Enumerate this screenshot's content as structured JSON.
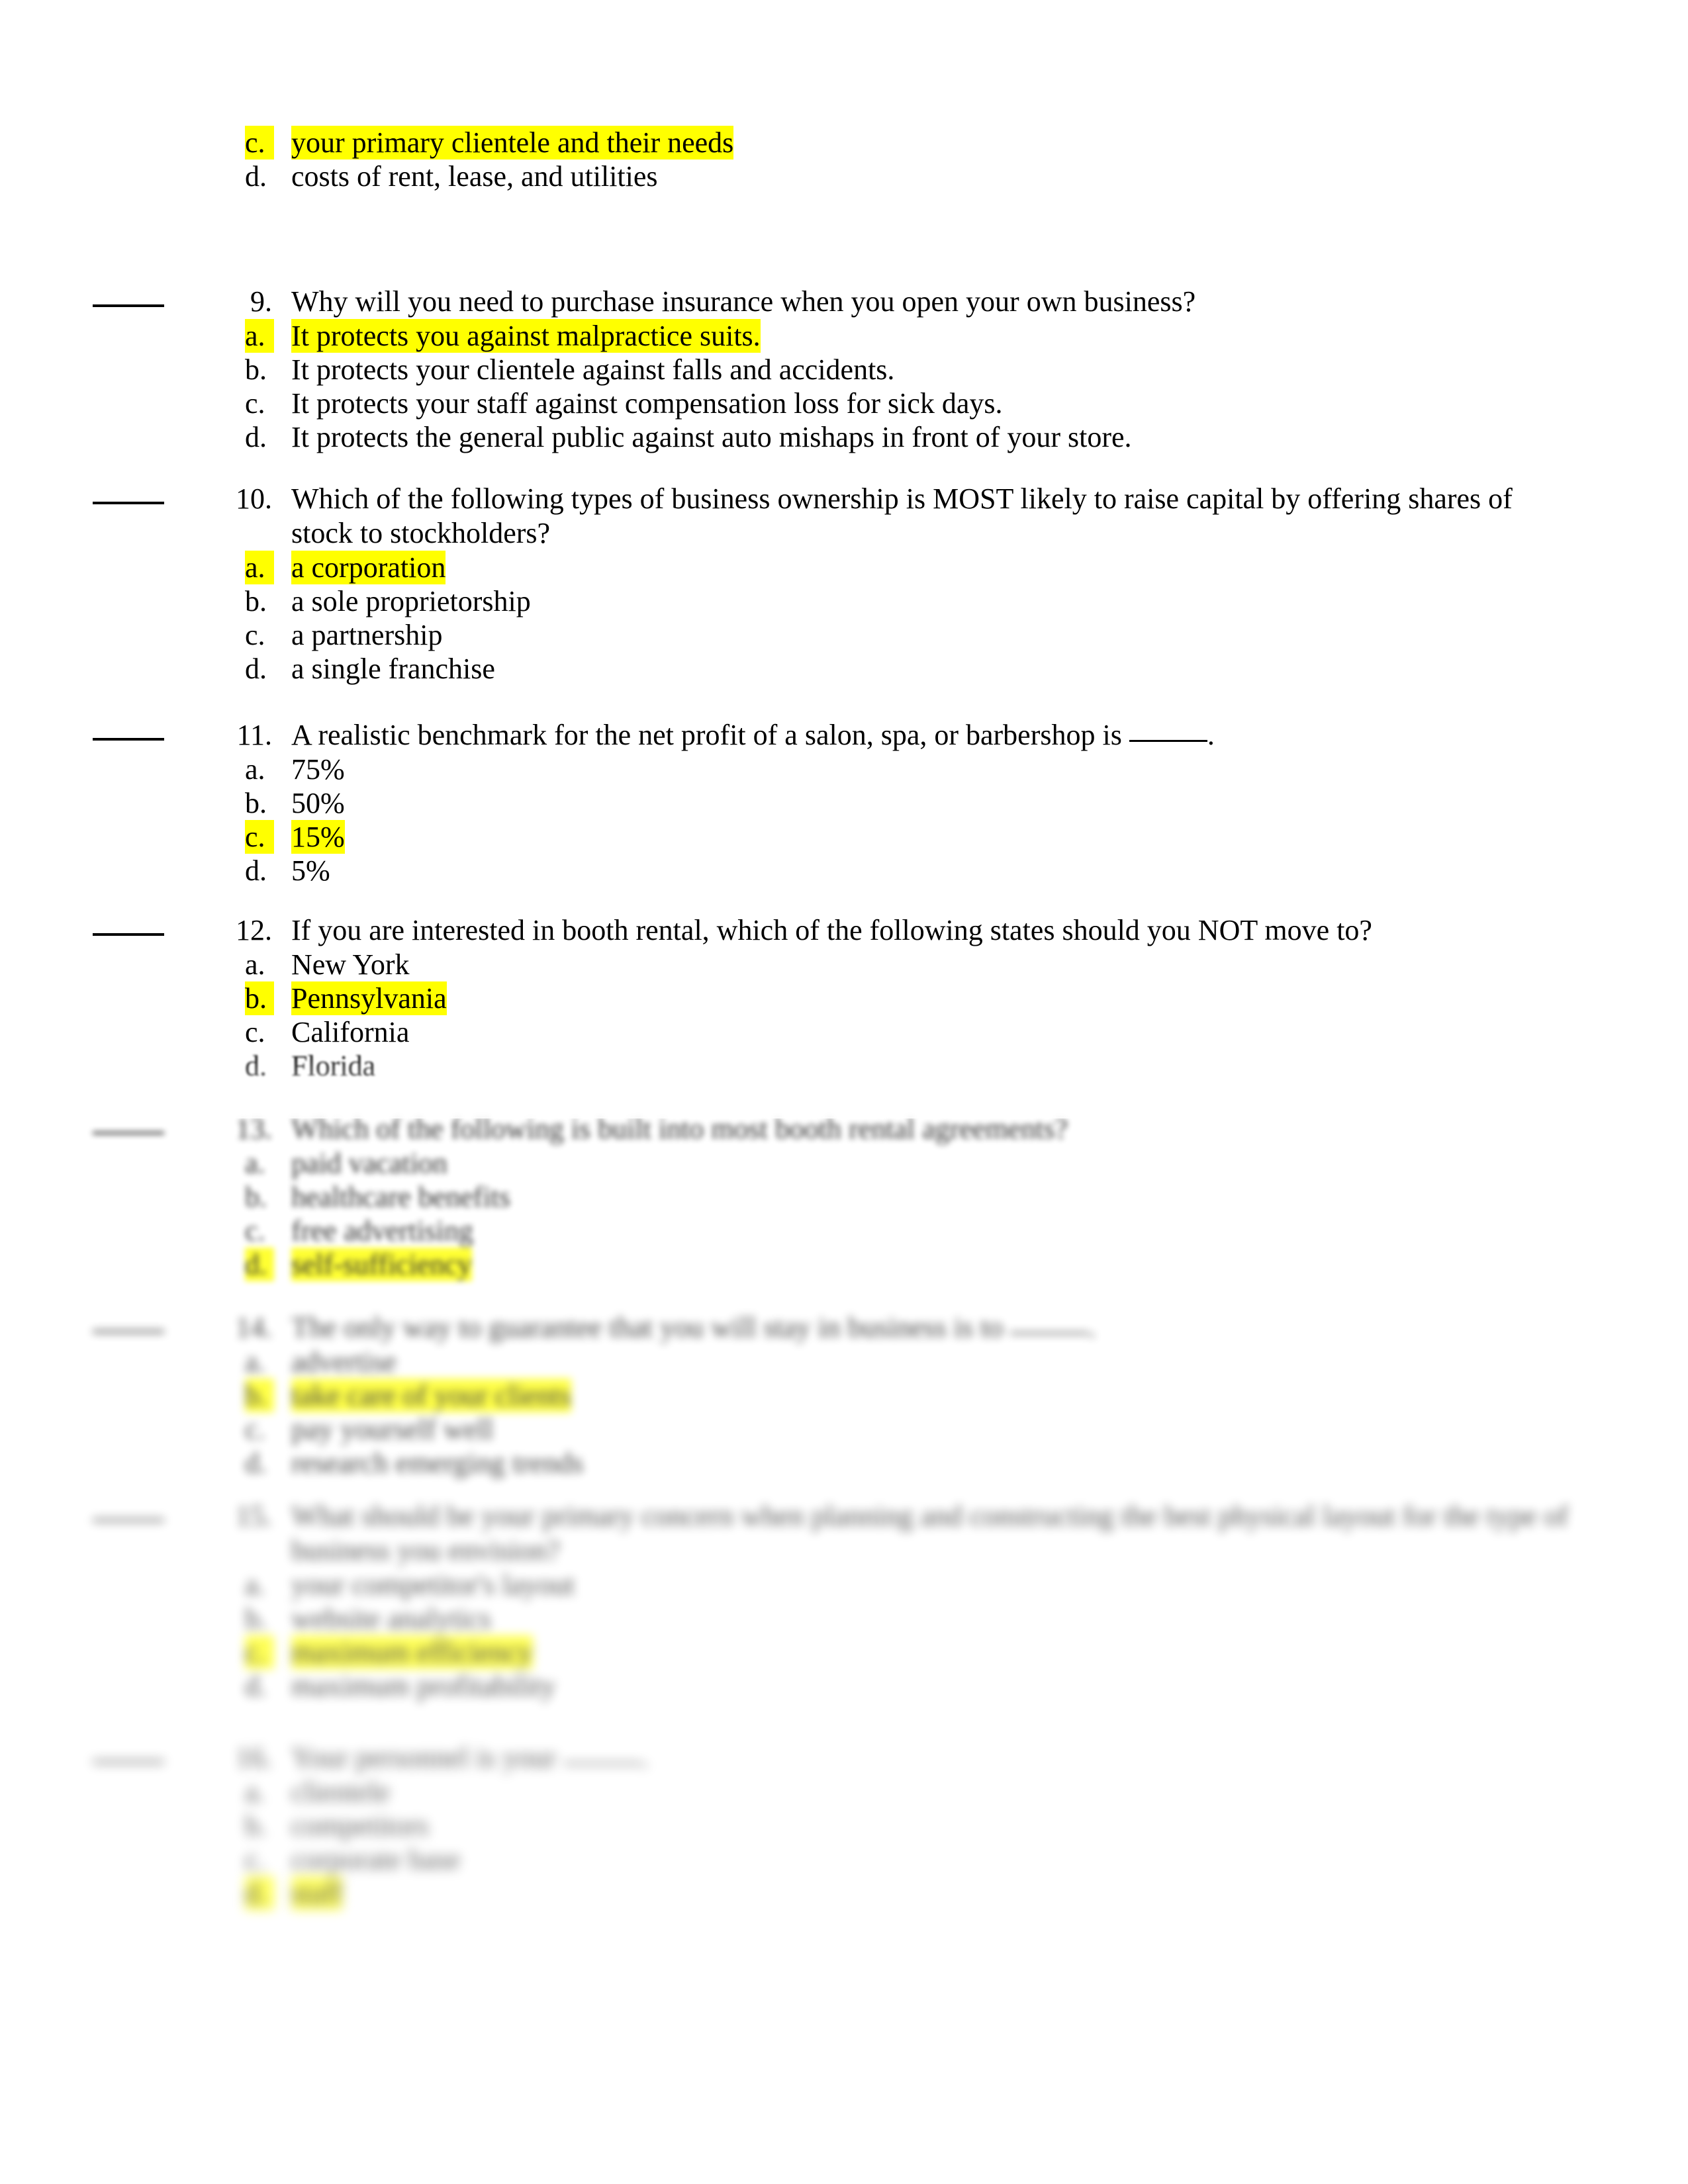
{
  "document": {
    "type": "multiple-choice-quiz-worksheet",
    "highlight_color": "#FFFF00",
    "page_background": "#FFFFFF",
    "text_color": "#000000"
  },
  "questions": [
    {
      "number": "",
      "partial": true,
      "text": "",
      "options": [
        {
          "marker": "c.",
          "text": "your primary clientele and their needs",
          "highlighted": true
        },
        {
          "marker": "d.",
          "text": "costs of rent, lease, and utilities",
          "highlighted": false
        }
      ]
    },
    {
      "number": "9.",
      "text": "Why will you need to purchase insurance when you open your own business?",
      "options": [
        {
          "marker": "a.",
          "text": "It protects you against malpractice suits.",
          "highlighted": true
        },
        {
          "marker": "b.",
          "text": "It protects your clientele against falls and accidents.",
          "highlighted": false
        },
        {
          "marker": "c.",
          "text": "It protects your staff against compensation loss for sick days.",
          "highlighted": false
        },
        {
          "marker": "d.",
          "text": "It protects the general public against auto mishaps in front of your store.",
          "highlighted": false
        }
      ]
    },
    {
      "number": "10.",
      "text": "Which of the following types of business ownership is MOST likely to raise capital by offering shares of",
      "text_cont": "stock to stockholders?",
      "options": [
        {
          "marker": "a.",
          "text": "a corporation",
          "highlighted": true
        },
        {
          "marker": "b.",
          "text": "a sole proprietorship",
          "highlighted": false
        },
        {
          "marker": "c.",
          "text": "a partnership",
          "highlighted": false
        },
        {
          "marker": "d.",
          "text": "a single franchise",
          "highlighted": false
        }
      ]
    },
    {
      "number": "11.",
      "text_before_blank": "A realistic benchmark for the net profit of a salon, spa, or barbershop is ",
      "text_after_blank": ".",
      "options": [
        {
          "marker": "a.",
          "text": "75%",
          "highlighted": false
        },
        {
          "marker": "b.",
          "text": "50%",
          "highlighted": false
        },
        {
          "marker": "c.",
          "text": "15%",
          "highlighted": true
        },
        {
          "marker": "d.",
          "text": "5%",
          "highlighted": false
        }
      ]
    },
    {
      "number": "12.",
      "text": "If you are interested in booth rental, which of the following states should you NOT move to?",
      "options": [
        {
          "marker": "a.",
          "text": "New York",
          "highlighted": false
        },
        {
          "marker": "b.",
          "text": "Pennsylvania",
          "highlighted": true
        },
        {
          "marker": "c.",
          "text": "California",
          "highlighted": false
        },
        {
          "marker": "d.",
          "text": "Florida",
          "highlighted": false
        }
      ]
    },
    {
      "number": "13.",
      "blurred": true,
      "text": "Which of the following is built into most booth rental agreements?",
      "options": [
        {
          "marker": "a.",
          "text": "paid vacation",
          "highlighted": false
        },
        {
          "marker": "b.",
          "text": "healthcare benefits",
          "highlighted": false
        },
        {
          "marker": "c.",
          "text": "free advertising",
          "highlighted": false
        },
        {
          "marker": "d.",
          "text": "self-sufficiency",
          "highlighted": true
        }
      ]
    },
    {
      "number": "14.",
      "blurred": true,
      "text_before_blank": "The only way to guarantee that you will stay in business is to ",
      "text_after_blank": ".",
      "options": [
        {
          "marker": "a.",
          "text": "advertise",
          "highlighted": false
        },
        {
          "marker": "b.",
          "text": "take care of your clients",
          "highlighted": true
        },
        {
          "marker": "c.",
          "text": "pay yourself well",
          "highlighted": false
        },
        {
          "marker": "d.",
          "text": "research emerging trends",
          "highlighted": false
        }
      ]
    },
    {
      "number": "15.",
      "blurred": true,
      "text": "What should be your primary concern when planning and constructing the best physical layout for the type of",
      "text_cont": "business you envision?",
      "options": [
        {
          "marker": "a.",
          "text": "your competitor's layout",
          "highlighted": false
        },
        {
          "marker": "b.",
          "text": "website analytics",
          "highlighted": false
        },
        {
          "marker": "c.",
          "text": "maximum efficiency",
          "highlighted": true
        },
        {
          "marker": "d.",
          "text": "maximum profitability",
          "highlighted": false
        }
      ]
    },
    {
      "number": "16.",
      "blurred": true,
      "text_before_blank": "Your personnel is your ",
      "text_after_blank": ".",
      "options": [
        {
          "marker": "a.",
          "text": "clientele",
          "highlighted": false
        },
        {
          "marker": "b.",
          "text": "competitors",
          "highlighted": false
        },
        {
          "marker": "c.",
          "text": "corporate base",
          "highlighted": false
        },
        {
          "marker": "d.",
          "text": "staff",
          "highlighted": true
        }
      ]
    }
  ]
}
